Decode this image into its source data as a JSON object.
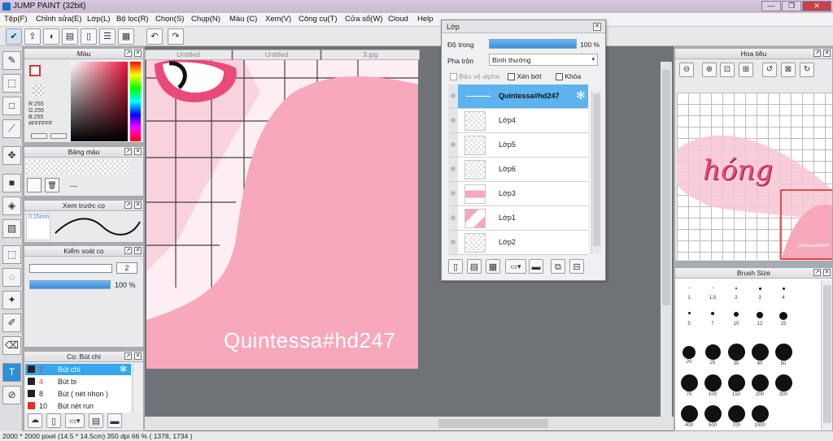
{
  "app": {
    "title": "JUMP PAINT (32bit)",
    "min": "—",
    "max": "❐",
    "close": "✕"
  },
  "menu": [
    "Tệp(F)",
    "Chỉnh sửa(E)",
    "Lớp(L)",
    "Bộ lọc(R)",
    "Chọn(S)",
    "Chụp(N)",
    "Màu (C)",
    "Xem(V)",
    "Công cụ(T)",
    "Cửa sổ(W)",
    "Cloud",
    "Help"
  ],
  "doc_tabs": [
    "Untitled",
    "Untitled",
    "3.jpg"
  ],
  "color_panel": {
    "title": "Màu",
    "r": "R:255",
    "g": "G:255",
    "b": "B:255",
    "hex": "#FFFFFF"
  },
  "palette_panel": {
    "title": "Bảng màu",
    "dash": "---"
  },
  "brushpreview_panel": {
    "title": "Xem trước cọ",
    "size": "0.15mm"
  },
  "brushcontrol_panel": {
    "title": "Kiểm soát cọ",
    "size_value": "2",
    "opacity_value": "100 %"
  },
  "brushlist_panel": {
    "title": "Cọ: Bút chì",
    "items": [
      {
        "num": "2",
        "name": "Bút chì",
        "color": "#222222",
        "selected": true
      },
      {
        "num": "4",
        "name": "Bút bi",
        "color": "#222222",
        "selected": false
      },
      {
        "num": "8",
        "name": "Bút ( nét nhọn )",
        "color": "#222222",
        "selected": false
      },
      {
        "num": "10",
        "name": "Bút nét run",
        "color": "#e03030",
        "selected": false
      }
    ]
  },
  "layer_panel": {
    "title": "Lớp",
    "opacity_label": "Độ trong",
    "opacity_value": "100 %",
    "opacity": 1.0,
    "blend_label": "Pha trộn",
    "blend_value": "Bình thường",
    "protect_alpha": "Bảo vệ alpha",
    "clip": "Xén bớt",
    "lock": "Khóa",
    "layers": [
      {
        "name": "Quintessa#hd247",
        "selected": true
      },
      {
        "name": "Lớp4",
        "selected": false
      },
      {
        "name": "Lớp5",
        "selected": false
      },
      {
        "name": "Lớp6",
        "selected": false
      },
      {
        "name": "Lớp3",
        "selected": false
      },
      {
        "name": "Lớp1",
        "selected": false
      },
      {
        "name": "Lớp2",
        "selected": false
      }
    ]
  },
  "navigator_panel": {
    "title": "Hoa tiêu",
    "preview_text": "hóng",
    "watermark": "Quintessa#hd247"
  },
  "brushsize_panel": {
    "title": "Brush Size",
    "sizes": [
      "1",
      "1.5",
      "2",
      "3",
      "4",
      "5",
      "7",
      "10",
      "12",
      "15",
      "20",
      "25",
      "30",
      "40",
      "50",
      "70",
      "100",
      "150",
      "200",
      "300",
      "400",
      "500",
      "700",
      "1000"
    ]
  },
  "canvas": {
    "watermark": "Quintessa#hd247"
  },
  "status": "2000 * 2000 pixel  (14.5 * 14.5cm)  350 dpi  66 %  ( 1378, 1734 )"
}
